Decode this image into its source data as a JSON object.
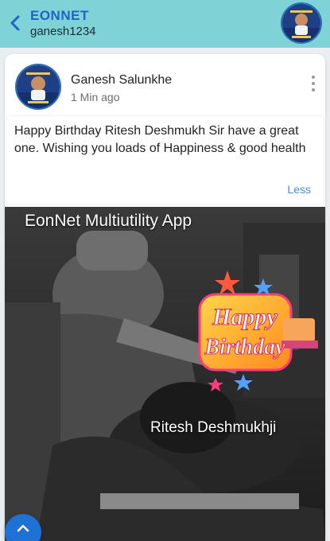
{
  "header": {
    "brand": "EONNET",
    "username": "ganesh1234"
  },
  "post": {
    "author": "Ganesh Salunkhe",
    "time": "1 Min ago",
    "message": "Happy Birthday Ritesh Deshmukh Sir have a great one. Wishing you loads of Happiness & good health",
    "less_label": "Less",
    "image_title": "EonNet Multiutility App",
    "image_name": "Ritesh Deshmukhji",
    "badge_line1": "Happy",
    "badge_line2": "Birthday"
  },
  "colors": {
    "topbar": "#7fd3d6",
    "brand": "#1e63c5",
    "link": "#4a8ed6",
    "fab": "#1e72d6"
  },
  "icons": {
    "back": "chevron-left-icon",
    "more": "more-vertical-icon",
    "scroll_top": "chevron-up-icon"
  }
}
